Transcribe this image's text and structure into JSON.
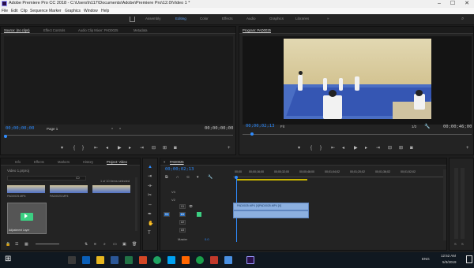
{
  "title_bar": {
    "title": "Adobe Premiere Pro CC 2018 - C:\\Users\\h117\\Documents\\Adobe\\Premiere Pro\\12.0\\Video 1 *"
  },
  "menu": [
    "File",
    "Edit",
    "Clip",
    "Sequence",
    "Marker",
    "Graphics",
    "Window",
    "Help"
  ],
  "workspaces": [
    "Assembly",
    "Editing",
    "Color",
    "Effects",
    "Audio",
    "Graphics",
    "Libraries"
  ],
  "active_workspace": "Editing",
  "source_panel": {
    "tabs": [
      "Source: (no clips)",
      "Effect Controls",
      "Audio Clip Mixer: PAD0025",
      "Metadata"
    ],
    "timecode_left": "00;00;00;00",
    "page_label": "Page 1",
    "timecode_right": "00;00;00;00"
  },
  "program_panel": {
    "tab": "Program: PAD0025",
    "timecode_left": "00;00;02;13",
    "fit_label": "Fit",
    "quality_label": "1/2",
    "timecode_right": "00;00;46;00"
  },
  "project_panel": {
    "tabs": [
      "Info",
      "Effects",
      "Markers",
      "History",
      "Project: Video"
    ],
    "project_name": "Video 1.prproj",
    "items_selected": "1 of 10 items selected",
    "clip_label_1": "PAD0025.MP4",
    "clip_label_2": "PAD0025.MP4",
    "clip_label_3": "Adjustment Layer"
  },
  "timeline": {
    "sequence_tab": "PAD0025",
    "timecode": "00;00;02;13",
    "ruler": [
      "00;00",
      "00;00;16;00",
      "00;00;32;00",
      "00;00;48;00",
      "00;01;04;02",
      "00;01;20;02",
      "00;01;36;02",
      "00;01;52;02"
    ],
    "video_tracks": [
      "V3",
      "V2",
      "V1"
    ],
    "audio_tracks": [
      "A1",
      "A2",
      "A3"
    ],
    "master_label": "Master",
    "master_value": "0.0",
    "clip_v1_label": "PAD0025.MP4 [V]",
    "clip_v1_label_b": "PAD0025.MP4 [V]"
  },
  "taskbar": {
    "time": "12:52 AM",
    "date": "5/3/2019",
    "lang": "ENG"
  }
}
